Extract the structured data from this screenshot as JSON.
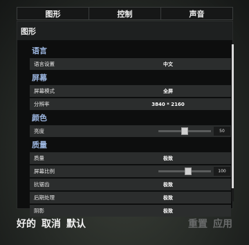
{
  "tabs": [
    "图形",
    "控制",
    "声音"
  ],
  "panel_title": "图形",
  "sections": {
    "language": "语言",
    "screen": "屏幕",
    "color": "颜色",
    "quality": "质量"
  },
  "rows": {
    "language_setting": {
      "label": "语言设置",
      "value": "中文"
    },
    "screen_mode": {
      "label": "屏幕模式",
      "value": "全屏"
    },
    "resolution": {
      "label": "分辨率",
      "value": "3840 * 2160"
    },
    "brightness": {
      "label": "亮度",
      "value": "50",
      "fraction": 0.5
    },
    "quality": {
      "label": "质量",
      "value": "极致"
    },
    "screen_ratio": {
      "label": "屏幕比例",
      "value": "100",
      "fraction": 0.58
    },
    "antialiasing": {
      "label": "抗锯齿",
      "value": "极致"
    },
    "post_processing": {
      "label": "后期处理",
      "value": "极致"
    },
    "shadows": {
      "label": "阴影",
      "value": "极致"
    }
  },
  "buttons": {
    "ok": "好的",
    "cancel": "取消",
    "default": "默认",
    "reset": "重置",
    "apply": "应用"
  },
  "colors": {
    "section_header": "#9cb6e0",
    "disabled_button": "#6a6c6c"
  }
}
